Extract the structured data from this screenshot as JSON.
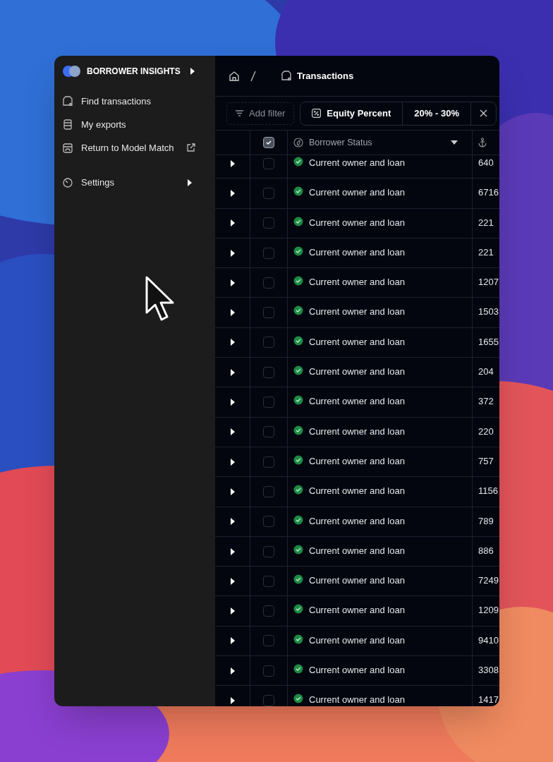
{
  "sidebar": {
    "title": "BORROWER INSIGHTS",
    "items": [
      {
        "label": "Find transactions",
        "kind": "link"
      },
      {
        "label": "My exports",
        "kind": "link"
      },
      {
        "label": "Return to Model Match",
        "kind": "external"
      },
      {
        "label": "Settings",
        "kind": "submenu"
      }
    ]
  },
  "breadcrumb": {
    "current": "Transactions"
  },
  "filters": {
    "add_label": "Add filter",
    "chips": [
      {
        "field": "Equity Percent",
        "value": "20% - 30%"
      }
    ]
  },
  "table": {
    "header_checked": true,
    "columns": [
      "Borrower Status"
    ],
    "rows": [
      {
        "status": "Current owner and loan",
        "address": "640",
        "checked": false
      },
      {
        "status": "Current owner and loan",
        "address": "6716",
        "checked": false
      },
      {
        "status": "Current owner and loan",
        "address": "221",
        "checked": false
      },
      {
        "status": "Current owner and loan",
        "address": "221",
        "checked": false
      },
      {
        "status": "Current owner and loan",
        "address": "1207",
        "checked": false
      },
      {
        "status": "Current owner and loan",
        "address": "1503",
        "checked": false
      },
      {
        "status": "Current owner and loan",
        "address": "1655",
        "checked": false
      },
      {
        "status": "Current owner and loan",
        "address": "204",
        "checked": false
      },
      {
        "status": "Current owner and loan",
        "address": "372",
        "checked": false
      },
      {
        "status": "Current owner and loan",
        "address": "220",
        "checked": false
      },
      {
        "status": "Current owner and loan",
        "address": "757",
        "checked": false
      },
      {
        "status": "Current owner and loan",
        "address": "1156",
        "checked": false
      },
      {
        "status": "Current owner and loan",
        "address": "789",
        "checked": false
      },
      {
        "status": "Current owner and loan",
        "address": "886",
        "checked": false
      },
      {
        "status": "Current owner and loan",
        "address": "7249",
        "checked": false
      },
      {
        "status": "Current owner and loan",
        "address": "1209",
        "checked": false
      },
      {
        "status": "Current owner and loan",
        "address": "9410",
        "checked": false
      },
      {
        "status": "Current owner and loan",
        "address": "3308",
        "checked": false
      },
      {
        "status": "Current owner and loan",
        "address": "1417",
        "checked": false
      }
    ]
  }
}
